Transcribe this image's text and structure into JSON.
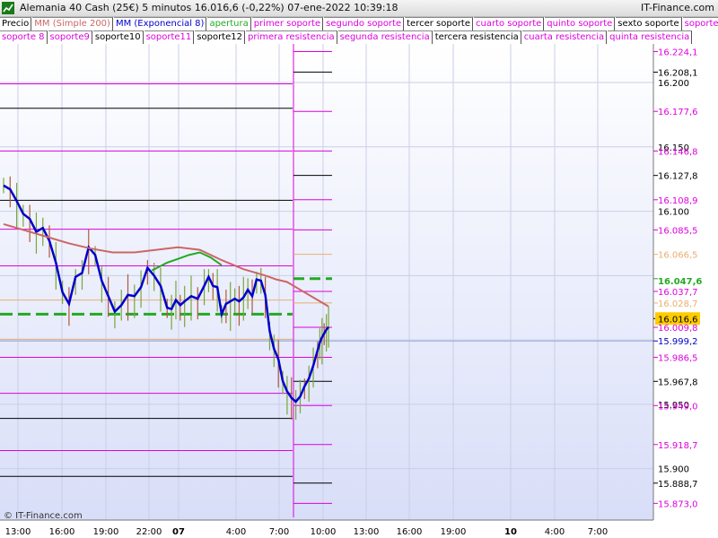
{
  "header": {
    "title": "Alemania 40 Cash (25€)   5 minutos   16.016,6 (-0,22%)   07-ene-2022 10:39:18",
    "brand": "IT-Finance.com"
  },
  "legend": [
    {
      "label": "Precio",
      "color": "#000000"
    },
    {
      "label": "MM (Simple 200)",
      "color": "#cc6666"
    },
    {
      "label": "MM (Exponencial 8)",
      "color": "#0000cc"
    },
    {
      "label": "apertura",
      "color": "#22aa22"
    },
    {
      "label": "primer soporte",
      "color": "#dd00dd"
    },
    {
      "label": "segundo soporte",
      "color": "#dd00dd"
    },
    {
      "label": "tercer soporte",
      "color": "#000000"
    },
    {
      "label": "cuarto soporte",
      "color": "#dd00dd"
    },
    {
      "label": "quinto soporte",
      "color": "#dd00dd"
    },
    {
      "label": "sexto soporte",
      "color": "#000000"
    },
    {
      "label": "soporte 7",
      "color": "#dd00dd"
    },
    {
      "label": "soporte 8",
      "color": "#dd00dd"
    },
    {
      "label": "soporte9",
      "color": "#dd00dd"
    },
    {
      "label": "soporte10",
      "color": "#000000"
    },
    {
      "label": "soporte11",
      "color": "#dd00dd"
    },
    {
      "label": "soporte12",
      "color": "#000000"
    },
    {
      "label": "primera resistencia",
      "color": "#dd00dd"
    },
    {
      "label": "segunda resistencia",
      "color": "#dd00dd"
    },
    {
      "label": "tercera resistencia",
      "color": "#000000"
    },
    {
      "label": "cuarta resistencia",
      "color": "#dd00dd"
    },
    {
      "label": "quinta resistencia",
      "color": "#dd00dd"
    }
  ],
  "watermark": "© IT-Finance.com",
  "chart_data": {
    "type": "line",
    "ylim": [
      15860,
      16230
    ],
    "x_ticks": [
      "13:00",
      "16:00",
      "19:00",
      "22:00",
      "07",
      "4:00",
      "7:00",
      "10:00",
      "13:00",
      "16:00",
      "19:00",
      "10",
      "4:00",
      "7:00"
    ],
    "y_ticks": [
      "16.200",
      "16.150",
      "16.100",
      "15.950",
      "15.900"
    ],
    "price_labels": [
      {
        "value": 16224.1,
        "label": "16.224,1",
        "color": "#dd00dd"
      },
      {
        "value": 16208.1,
        "label": "16.208,1",
        "color": "#000000"
      },
      {
        "value": 16177.6,
        "label": "16.177,6",
        "color": "#dd00dd"
      },
      {
        "value": 16146.8,
        "label": "16.146,8",
        "color": "#dd00dd"
      },
      {
        "value": 16127.8,
        "label": "16.127,8",
        "color": "#000000"
      },
      {
        "value": 16108.9,
        "label": "16.108,9",
        "color": "#dd00dd"
      },
      {
        "value": 16085.5,
        "label": "16.085,5",
        "color": "#dd00dd"
      },
      {
        "value": 16066.5,
        "label": "16.066,5",
        "color": "#e6b070"
      },
      {
        "value": 16047.6,
        "label": "16.047,6",
        "color": "#22aa22"
      },
      {
        "value": 16037.7,
        "label": "16.037,7",
        "color": "#dd00dd"
      },
      {
        "value": 16028.7,
        "label": "16.028,7",
        "color": "#e6b070"
      },
      {
        "value": 16016.6,
        "label": "16.016,6",
        "color": "#000000"
      },
      {
        "value": 16009.8,
        "label": "16.009,8",
        "color": "#dd00dd"
      },
      {
        "value": 15999.2,
        "label": "15.999,2",
        "color": "#0000cc"
      },
      {
        "value": 15986.5,
        "label": "15.986,5",
        "color": "#dd00dd"
      },
      {
        "value": 15967.8,
        "label": "15.967,8",
        "color": "#000000"
      },
      {
        "value": 15949.0,
        "label": "15.949,0",
        "color": "#dd00dd"
      },
      {
        "value": 15918.7,
        "label": "15.918,7",
        "color": "#dd00dd"
      },
      {
        "value": 15888.7,
        "label": "15.888,7",
        "color": "#000000"
      },
      {
        "value": 15873.0,
        "label": "15.873,0",
        "color": "#dd00dd"
      }
    ],
    "levels_prev_session": [
      {
        "value": 16199.0,
        "color": "#dd00dd"
      },
      {
        "value": 16180.0,
        "color": "#000000"
      },
      {
        "value": 16146.8,
        "color": "#dd00dd"
      },
      {
        "value": 16108.5,
        "color": "#000000"
      },
      {
        "value": 16086.0,
        "color": "#dd00dd"
      },
      {
        "value": 16057.5,
        "color": "#dd00dd"
      },
      {
        "value": 16031.0,
        "color": "#e6b070"
      },
      {
        "value": 16020.0,
        "color": "#22aa22",
        "dashed": true
      },
      {
        "value": 16000.5,
        "color": "#e6b070"
      },
      {
        "value": 15986.5,
        "color": "#dd00dd"
      },
      {
        "value": 15958.5,
        "color": "#dd00dd"
      },
      {
        "value": 15939.0,
        "color": "#000000"
      },
      {
        "value": 15914.0,
        "color": "#dd00dd"
      },
      {
        "value": 15894.0,
        "color": "#000000"
      }
    ],
    "levels_current_session": [
      {
        "value": 16224.1,
        "color": "#dd00dd"
      },
      {
        "value": 16208.1,
        "color": "#000000"
      },
      {
        "value": 16177.6,
        "color": "#dd00dd"
      },
      {
        "value": 16146.8,
        "color": "#dd00dd"
      },
      {
        "value": 16127.8,
        "color": "#000000"
      },
      {
        "value": 16108.9,
        "color": "#dd00dd"
      },
      {
        "value": 16085.5,
        "color": "#dd00dd"
      },
      {
        "value": 16066.5,
        "color": "#e6b070"
      },
      {
        "value": 16047.6,
        "color": "#22aa22",
        "dashed": true
      },
      {
        "value": 16037.7,
        "color": "#dd00dd"
      },
      {
        "value": 16028.7,
        "color": "#e6b070"
      },
      {
        "value": 16009.8,
        "color": "#dd00dd"
      },
      {
        "value": 15986.5,
        "color": "#dd00dd"
      },
      {
        "value": 15967.8,
        "color": "#000000"
      },
      {
        "value": 15949.0,
        "color": "#dd00dd"
      },
      {
        "value": 15918.7,
        "color": "#dd00dd"
      },
      {
        "value": 15888.7,
        "color": "#000000"
      },
      {
        "value": 15873.0,
        "color": "#dd00dd"
      }
    ],
    "series": [
      {
        "name": "MM (Exponencial 8)",
        "color": "#0000cc",
        "x": [
          0,
          3,
          6,
          9,
          12,
          15,
          18,
          21,
          24,
          27,
          30,
          33,
          36,
          39,
          42,
          45,
          48,
          51,
          54,
          57,
          60,
          63,
          66,
          69,
          72,
          75,
          77,
          79,
          81,
          83,
          86,
          89,
          92,
          94,
          96,
          98,
          100,
          102,
          104,
          106,
          108,
          110,
          112,
          114,
          116,
          118,
          120,
          122,
          124,
          126,
          128,
          130,
          132,
          134,
          136,
          138,
          140,
          142,
          144,
          145,
          146,
          147,
          148,
          149
        ],
        "y": [
          16120,
          16117,
          16108,
          16098,
          16094,
          16084,
          16087,
          16077,
          16060,
          16037,
          16028,
          16049,
          16052,
          16072,
          16066,
          16046,
          16034,
          16022,
          16027,
          16035,
          16034,
          16041,
          16056,
          16050,
          16042,
          16025,
          16024,
          16031,
          16027,
          16030,
          16034,
          16032,
          16042,
          16049,
          16042,
          16041,
          16020,
          16028,
          16030,
          16032,
          16030,
          16033,
          16039,
          16034,
          16047,
          16046,
          16035,
          16007,
          15993,
          15985,
          15968,
          15960,
          15955,
          15952,
          15956,
          15964,
          15970,
          15980,
          15992,
          15998,
          16002,
          16005,
          16008,
          16010
        ]
      },
      {
        "name": "MM (Simple 200)",
        "color": "#cc6666",
        "x": [
          0,
          10,
          20,
          30,
          40,
          50,
          60,
          70,
          80,
          90,
          100,
          110,
          120,
          125,
          130,
          135,
          140,
          145,
          149
        ],
        "y": [
          16090,
          16085,
          16080,
          16075,
          16071,
          16068,
          16068,
          16070,
          16072,
          16070,
          16062,
          16055,
          16050,
          16047,
          16045,
          16040,
          16035,
          16030,
          16026
        ]
      },
      {
        "name": "apertura",
        "color": "#22aa22",
        "x": [
          68,
          75,
          80,
          85,
          90,
          95,
          100
        ],
        "y": [
          16054,
          16060,
          16063,
          16066,
          16068,
          16064,
          16058
        ]
      }
    ]
  }
}
